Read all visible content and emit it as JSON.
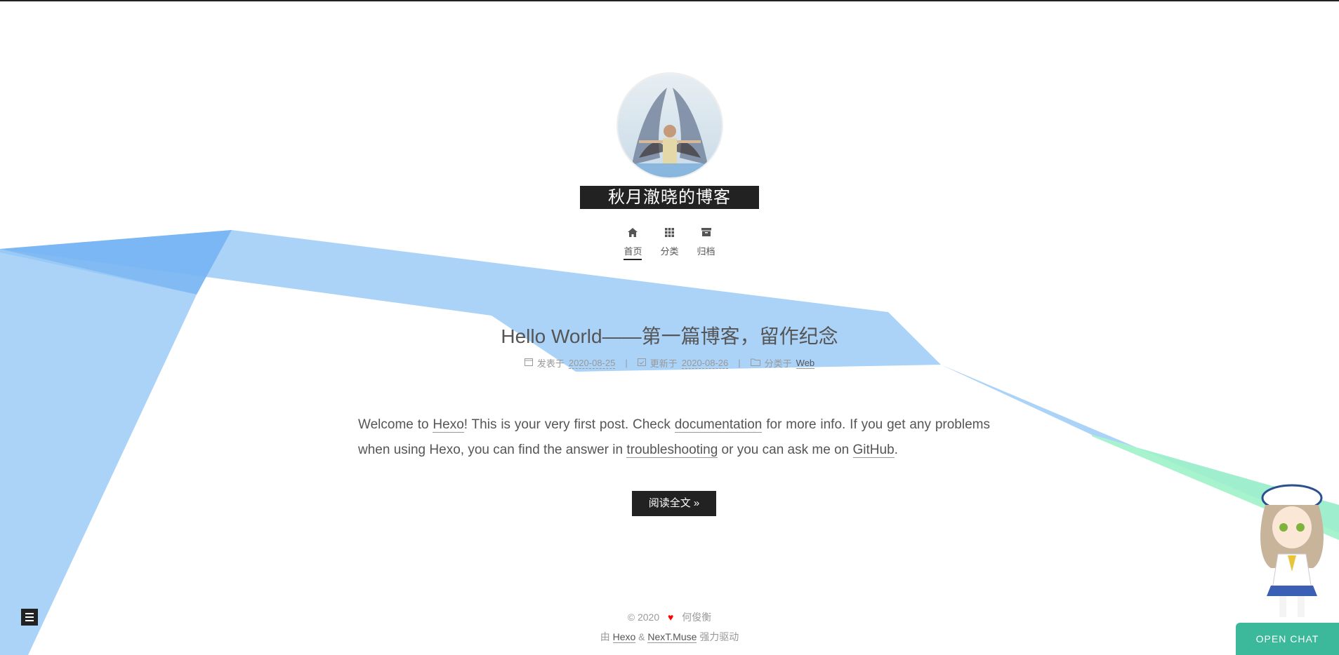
{
  "site": {
    "title": "秋月澈晓的博客"
  },
  "menu": {
    "items": [
      {
        "label": "首页",
        "icon": "home-icon"
      },
      {
        "label": "分类",
        "icon": "grid-icon"
      },
      {
        "label": "归档",
        "icon": "archive-icon"
      }
    ]
  },
  "post": {
    "title": "Hello World——第一篇博客，留作纪念",
    "meta": {
      "published_label": "发表于",
      "published_date": "2020-08-25",
      "separator": "|",
      "updated_label": "更新于",
      "updated_date": "2020-08-26",
      "category_label": "分类于",
      "category": "Web"
    },
    "body": {
      "t1": "Welcome to ",
      "link_hexo": "Hexo",
      "t2": "! This is your very first post. Check ",
      "link_docs": "documentation",
      "t3": " for more info. If you get any problems when using Hexo, you can find the answer in ",
      "link_trouble": "troubleshooting",
      "t4": " or you can ask me on ",
      "link_github": "GitHub",
      "t5": "."
    },
    "read_more": "阅读全文 »"
  },
  "footer": {
    "copyright": "© 2020",
    "heart": "♥",
    "author": "何俊衡",
    "powered_prefix": "由",
    "powered_hexo": "Hexo",
    "powered_amp": "&",
    "powered_theme": "NexT.Muse",
    "powered_suffix": "强力驱动"
  },
  "chat": {
    "label": "OPEN CHAT"
  },
  "colors": {
    "ribbon_blue": "#8cc4f5",
    "ribbon_green": "#8ef0c0",
    "chat_green": "#3bb99a",
    "title_bg": "#222222"
  }
}
